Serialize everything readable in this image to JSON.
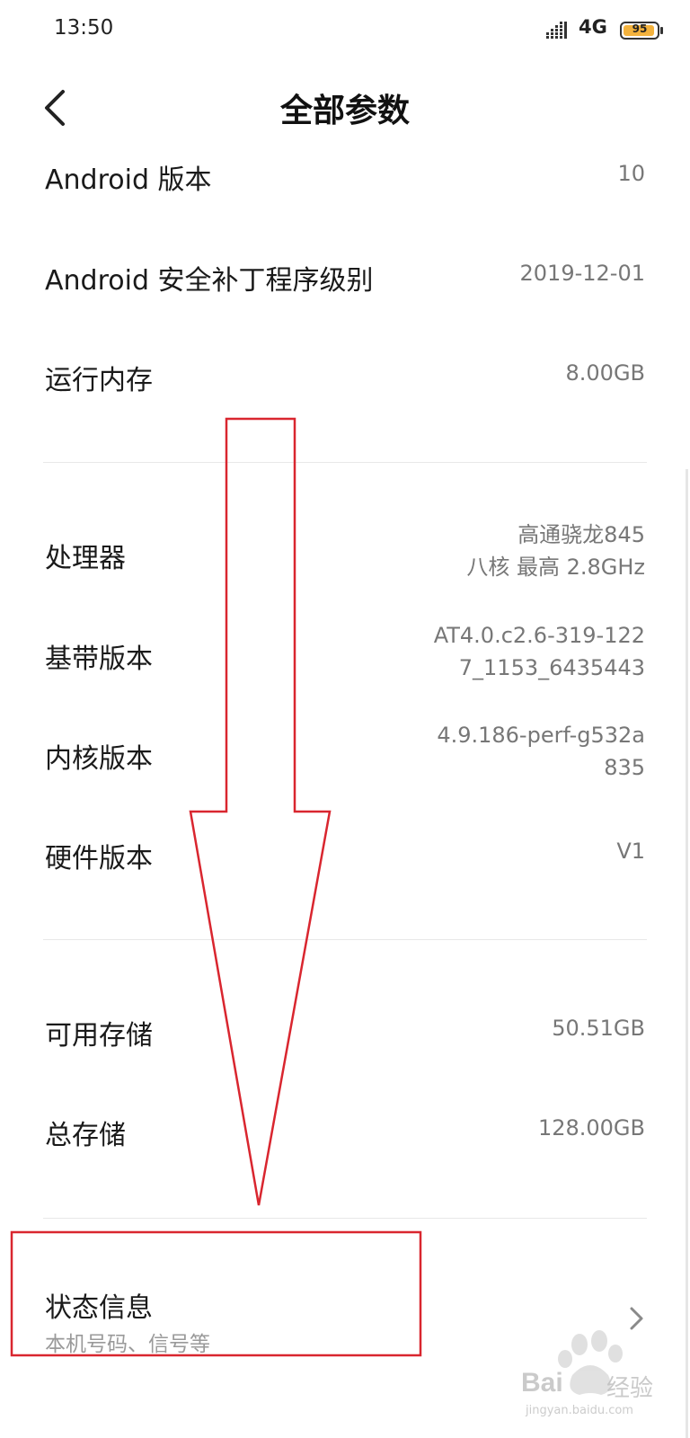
{
  "status_bar": {
    "time": "13:50",
    "network": "4G",
    "battery": "95",
    "battery_level": 0.95
  },
  "header": {
    "title": "全部参数"
  },
  "params": [
    {
      "label": "Android 版本",
      "value": [
        "10"
      ]
    },
    {
      "label": "Android 安全补丁程序级别",
      "value": [
        "2019-12-01"
      ]
    },
    {
      "label": "运行内存",
      "value": [
        "8.00GB"
      ]
    },
    {
      "label": "处理器",
      "value": [
        "高通骁龙845",
        "八核 最高 2.8GHz"
      ]
    },
    {
      "label": "基带版本",
      "value": [
        "AT4.0.c2.6-319-122",
        "7_1153_6435443"
      ]
    },
    {
      "label": "内核版本",
      "value": [
        "4.9.186-perf-g532a",
        "835"
      ]
    },
    {
      "label": "硬件版本",
      "value": [
        "V1"
      ]
    },
    {
      "label": "可用存储",
      "value": [
        "50.51GB"
      ]
    },
    {
      "label": "总存储",
      "value": [
        "128.00GB"
      ]
    }
  ],
  "status_info": {
    "label": "状态信息",
    "subtitle": "本机号码、信号等"
  },
  "watermark": {
    "brand": "Bai",
    "brand_tail": "经验",
    "url": "jingyan.baidu.com"
  },
  "colors": {
    "annotation": "#d9262f",
    "battery_fill": "#f3b23d"
  }
}
